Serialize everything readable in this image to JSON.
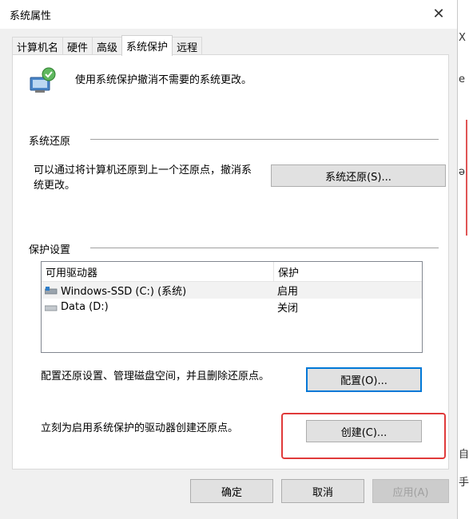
{
  "window": {
    "title": "系统属性",
    "close": "✕"
  },
  "tabs": [
    {
      "label": "计算机名"
    },
    {
      "label": "硬件"
    },
    {
      "label": "高级"
    },
    {
      "label": "系统保护"
    },
    {
      "label": "远程"
    }
  ],
  "header": {
    "text": "使用系统保护撤消不需要的系统更改。"
  },
  "restore": {
    "section_title": "系统还原",
    "description_line1": "可以通过将计算机还原到上一个还原点，撤消系",
    "description_line2": "统更改。",
    "button_label": "系统还原(S)..."
  },
  "protection": {
    "section_title": "保护设置",
    "columns": [
      "可用驱动器",
      "保护"
    ],
    "drives": [
      {
        "name": "Windows-SSD (C:) (系统)",
        "status": "启用"
      },
      {
        "name": "Data (D:)",
        "status": "关闭"
      }
    ],
    "configure_text": "配置还原设置、管理磁盘空间，并且删除还原点。",
    "configure_button": "配置(O)...",
    "create_text": "立刻为启用系统保护的驱动器创建还原点。",
    "create_button": "创建(C)..."
  },
  "footer": {
    "ok": "确定",
    "cancel": "取消",
    "apply": "应用(A)"
  },
  "background": {
    "frag1": "X",
    "frag2": "e",
    "frag3": "ə",
    "frag4": "自",
    "frag5": "手"
  },
  "colors": {
    "accent": "#0078d7",
    "highlight": "#e03a3a"
  }
}
